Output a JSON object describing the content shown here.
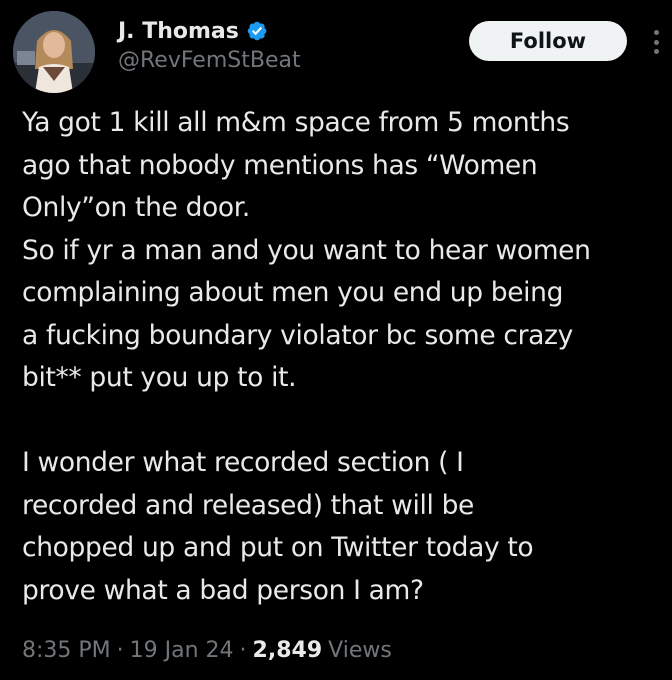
{
  "author": {
    "display_name": "J. Thomas",
    "handle": "@RevFemStBeat",
    "verified": true,
    "avatar": "profile-photo"
  },
  "actions": {
    "follow_label": "Follow",
    "more_icon": "more-vertical-icon"
  },
  "tweet": {
    "lines": [
      "Ya got 1 kill all m&m space from 5 months",
      "ago that nobody mentions has “Women",
      "Only”on the door.",
      "So if yr a man and you want to hear women",
      "complaining about men you end up being",
      "a fucking boundary violator bc some crazy",
      "bit** put you up to it.",
      "",
      "I wonder what recorded section ( I",
      "recorded and released) that will be",
      "chopped up and put on Twitter today to",
      "prove what a bad person I am?"
    ]
  },
  "meta": {
    "time": "8:35 PM",
    "date": "19 Jan 24",
    "separator": "·",
    "views_count": "2,849",
    "views_label": "Views"
  },
  "colors": {
    "background": "#000000",
    "text": "#e7e9ea",
    "muted": "#71767b",
    "verified_badge": "#1d9bf0",
    "follow_button_bg": "#eff3f4"
  }
}
